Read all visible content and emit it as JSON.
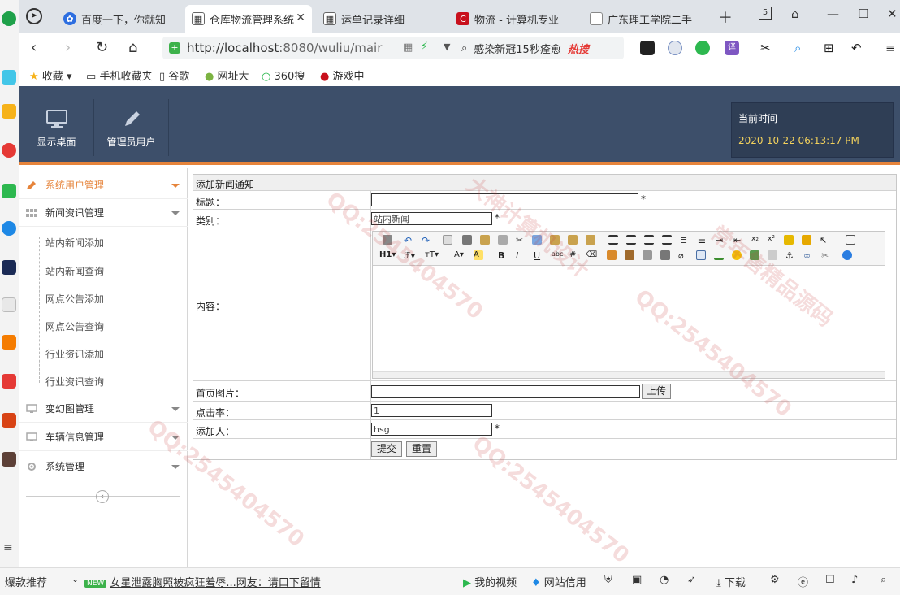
{
  "browser": {
    "tabs": [
      {
        "label": "百度一下，你就知",
        "icon": "baidu-icon",
        "color": "#2d6ee0"
      },
      {
        "label": "仓库物流管理系统",
        "icon": "page-icon",
        "active": true
      },
      {
        "label": "运单记录详细",
        "icon": "page-icon"
      },
      {
        "label": "物流 - 计算机专业",
        "icon": "csdn-icon",
        "color": "#c8101c"
      },
      {
        "label": "广东理工学院二手",
        "icon": "doc-icon"
      }
    ],
    "tab_count": "5",
    "url_host": "http://localhost",
    "url_rest": ":8080/wuliu/mair",
    "search_text": "感染新冠15秒痊愈",
    "search_hot": "热搜",
    "bookmarks": [
      "收藏",
      "手机收藏夹",
      "谷歌",
      "网址大",
      "360搜",
      "游戏中"
    ]
  },
  "header": {
    "buttons": [
      {
        "label": "显示桌面",
        "icon": "monitor-icon"
      },
      {
        "label": "管理员用户",
        "icon": "pencil-icon"
      }
    ],
    "time_label": "当前时间",
    "time_value": "2020-10-22 06:13:17 PM"
  },
  "sidebar": {
    "groups": [
      {
        "label": "系统用户管理",
        "active": true
      },
      {
        "label": "新闻资讯管理"
      },
      {
        "label": "变幻图管理"
      },
      {
        "label": "车辆信息管理"
      },
      {
        "label": "系统管理"
      }
    ],
    "subitems": [
      "站内新闻添加",
      "站内新闻查询",
      "网点公告添加",
      "网点公告查询",
      "行业资讯添加",
      "行业资讯查询"
    ]
  },
  "form": {
    "title": "添加新闻通知",
    "title_label": "标题：",
    "title_value": "",
    "category_label": "类别：",
    "category_value": "站内新闻",
    "content_label": "内容：",
    "image_label": "首页图片：",
    "image_value": "",
    "upload_label": "上传",
    "clicks_label": "点击率：",
    "clicks_value": "1",
    "author_label": "添加人：",
    "author_value": "hsg",
    "required_mark": "*",
    "submit_label": "提交",
    "reset_label": "重置",
    "editor_heading": "H1",
    "editor_font_size": "T"
  },
  "statusbar": {
    "left": "爆款推荐",
    "new_badge": "NEW",
    "news": "女星泄露胸照被疯狂羞辱...网友：请口下留情",
    "video": "我的视频",
    "credit": "网站信用",
    "download": "下载"
  },
  "watermark": {
    "text1": "QQ:2545404570",
    "text2": "大神计算机设计",
    "text3": "常年售精品源码"
  }
}
